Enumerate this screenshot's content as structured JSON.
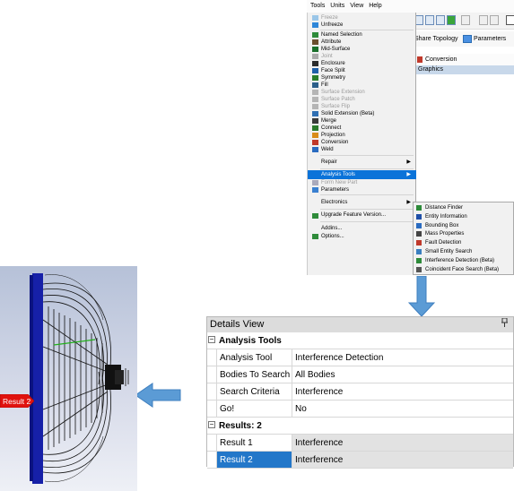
{
  "menu_bar": {
    "items": [
      "Tools",
      "Units",
      "View",
      "Help"
    ]
  },
  "toolbar": {
    "share_topology": "Share Topology",
    "parameters": "Parameters"
  },
  "tree": {
    "conversion": "Conversion",
    "graphics": "Graphics"
  },
  "tools_menu": {
    "items": [
      {
        "label": "Freeze",
        "disabled": true,
        "icon": "freeze-icon"
      },
      {
        "label": "Unfreeze",
        "disabled": false,
        "icon": "unfreeze-icon"
      },
      {
        "label": "Named Selection",
        "disabled": false,
        "icon": "named-selection-icon"
      },
      {
        "label": "Attribute",
        "disabled": false,
        "icon": "attribute-icon"
      },
      {
        "label": "Mid-Surface",
        "disabled": false,
        "icon": "mid-surface-icon"
      },
      {
        "label": "Joint",
        "disabled": true,
        "icon": "joint-icon"
      },
      {
        "label": "Enclosure",
        "disabled": false,
        "icon": "enclosure-icon"
      },
      {
        "label": "Face Split",
        "disabled": false,
        "icon": "face-split-icon"
      },
      {
        "label": "Symmetry",
        "disabled": false,
        "icon": "symmetry-icon"
      },
      {
        "label": "Fill",
        "disabled": false,
        "icon": "fill-icon"
      },
      {
        "label": "Surface Extension",
        "disabled": true,
        "icon": "surface-extension-icon"
      },
      {
        "label": "Surface Patch",
        "disabled": true,
        "icon": "surface-patch-icon"
      },
      {
        "label": "Surface Flip",
        "disabled": true,
        "icon": "surface-flip-icon"
      },
      {
        "label": "Solid Extension (Beta)",
        "disabled": false,
        "icon": "solid-extension-icon"
      },
      {
        "label": "Merge",
        "disabled": false,
        "icon": "merge-icon"
      },
      {
        "label": "Connect",
        "disabled": false,
        "icon": "connect-icon"
      },
      {
        "label": "Projection",
        "disabled": false,
        "icon": "projection-icon"
      },
      {
        "label": "Conversion",
        "disabled": false,
        "icon": "conversion-icon"
      },
      {
        "label": "Weld",
        "disabled": false,
        "icon": "weld-icon"
      }
    ],
    "repair": "Repair",
    "analysis_tools": "Analysis Tools",
    "form_new_part": "Form New Part",
    "parameters": "Parameters",
    "electronics": "Electronics",
    "upgrade": "Upgrade Feature Version...",
    "addins": "Addins...",
    "options": "Options..."
  },
  "analysis_submenu": {
    "items": [
      {
        "label": "Distance Finder",
        "icon": "distance-finder-icon"
      },
      {
        "label": "Entity Information",
        "icon": "entity-information-icon"
      },
      {
        "label": "Bounding Box",
        "icon": "bounding-box-icon"
      },
      {
        "label": "Mass Properties",
        "icon": "mass-properties-icon"
      },
      {
        "label": "Fault Detection",
        "icon": "fault-detection-icon"
      },
      {
        "label": "Small Entity Search",
        "icon": "small-entity-search-icon"
      },
      {
        "label": "Interference Detection (Beta)",
        "icon": "interference-detection-icon"
      },
      {
        "label": "Coincident Face Search (Beta)",
        "icon": "coincident-face-search-icon"
      }
    ]
  },
  "details_view": {
    "title": "Details View",
    "pin": "p",
    "group1": {
      "title": "Analysis Tools",
      "toggle": "−"
    },
    "rows": [
      {
        "key": "Analysis Tool",
        "value": "Interference Detection"
      },
      {
        "key": "Bodies To Search",
        "value": "All Bodies"
      },
      {
        "key": "Search Criteria",
        "value": "Interference"
      },
      {
        "key": "Go!",
        "value": "No"
      }
    ],
    "group2": {
      "title": "Results: 2",
      "toggle": "−"
    },
    "results": [
      {
        "key": "Result 1",
        "value": "Interference"
      },
      {
        "key": "Result 2",
        "value": "Interference"
      }
    ]
  },
  "model_view": {
    "result_label": "Result 2"
  },
  "colors": {
    "accent": "#0b73d9",
    "selected_row": "#2377c9",
    "arrow": "#5b9bd5",
    "result_tag": "#e0120e"
  }
}
